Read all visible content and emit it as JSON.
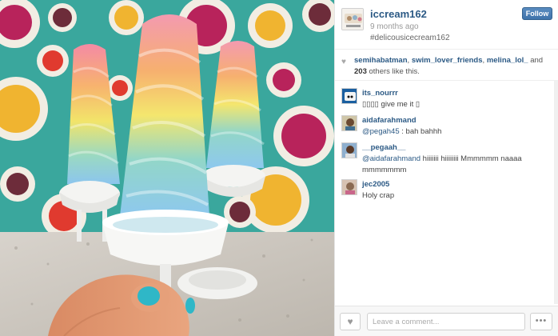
{
  "post": {
    "username": "iccream162",
    "time_ago": "9 months ago",
    "caption": "#delicousicecream162",
    "follow_label": "Follow"
  },
  "likes": {
    "likers": [
      "semihabatman",
      "swim_lover_friends",
      "melina_lol_"
    ],
    "separator": ", ",
    "and_text": " and",
    "others_count": "203",
    "others_text": " others like this."
  },
  "comments": [
    {
      "user": "its_nourrr",
      "mention": "",
      "text": "▯▯▯▯ give me it ▯"
    },
    {
      "user": "aidafarahmand",
      "mention": "@pegah45",
      "text": " : bah bahhh"
    },
    {
      "user": "__pegaah__",
      "mention": "@aidafarahmand",
      "text": " hiiiiiii hiiiiiiii Mmmmmm naaaa mmmmmmm"
    },
    {
      "user": "jec2005",
      "mention": "",
      "text": "Holy crap"
    }
  ],
  "footer": {
    "comment_placeholder": "Leave a comment...",
    "more_label": "•••"
  },
  "colors": {
    "link": "#2c5a85",
    "follow_button": "#4a7fb5",
    "photo_background": "#3aa79d"
  },
  "icons": {
    "like": "heart-icon",
    "likes_indicator": "heart-icon",
    "more": "ellipsis-icon"
  }
}
